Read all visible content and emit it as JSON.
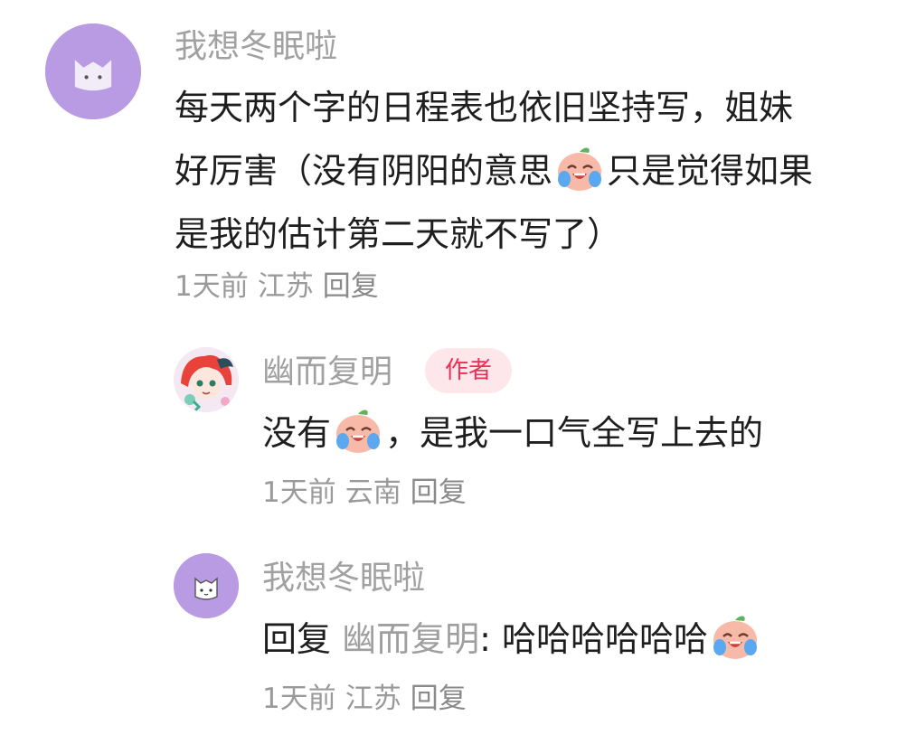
{
  "comments": [
    {
      "user": "我想冬眠啦",
      "text_lines": [
        "每天两个字的日程表也依旧坚持写，姐妹",
        "好厉害（没有阴阳的意思",
        "只是觉得如果",
        "是我的估计第二天就不写了）"
      ],
      "time": "1天前",
      "location": "江苏",
      "reply_label": "回复",
      "avatar_icon": "cat-avatar-icon"
    }
  ],
  "replies": [
    {
      "user": "幽而复明",
      "badge": "作者",
      "text_before": "没有",
      "text_after": "，是我一口气全写上去的",
      "time": "1天前",
      "location": "云南",
      "reply_label": "回复",
      "avatar_icon": "anime-avatar-icon"
    },
    {
      "user": "我想冬眠啦",
      "reply_prefix": "回复",
      "reply_to": "幽而复明",
      "colon": ":",
      "text": "哈哈哈哈哈哈",
      "time": "1天前",
      "location": "江苏",
      "reply_label": "回复",
      "avatar_icon": "cat-avatar-icon"
    }
  ],
  "emoji_name": "laugh-cry-peach-emoji-icon",
  "colors": {
    "avatar_purple": "#b99be3",
    "badge_bg": "#fde7ea",
    "badge_text": "#ee2f55",
    "muted": "#a1a1a1"
  }
}
